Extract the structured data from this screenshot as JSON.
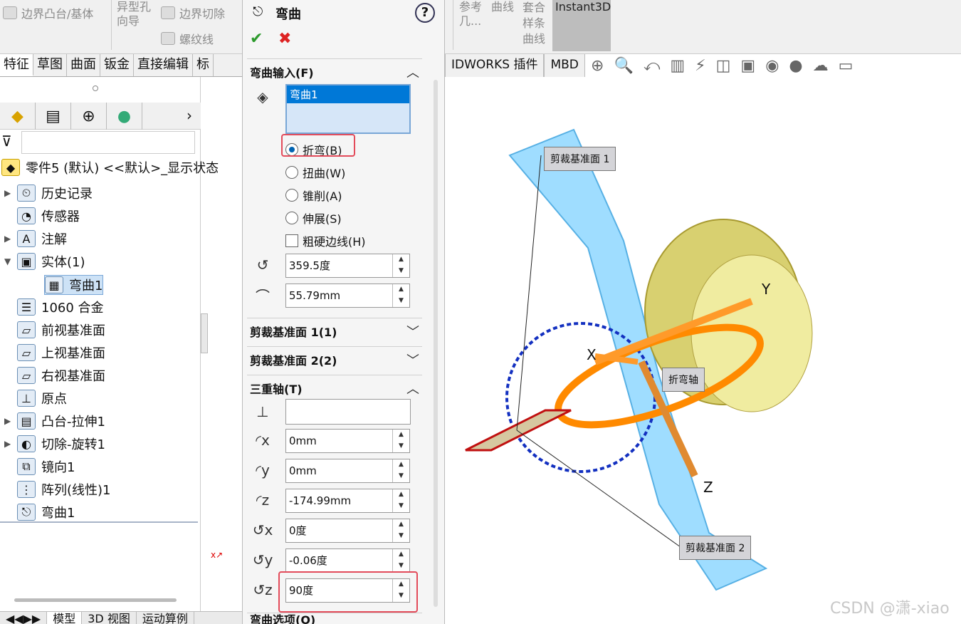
{
  "ribbon": {
    "boundary_boss": "边界凸台/基体",
    "hole_wizard": "异型孔\n向导",
    "boundary_cut": "边界切除",
    "thread": "螺纹线",
    "ref_geom": "参考\n几...",
    "curves": "曲线",
    "sketch_spline": "套合\n样条\n曲线",
    "instant3d": "Instant3D"
  },
  "tabs": [
    "特征",
    "草图",
    "曲面",
    "钣金",
    "直接编辑",
    "标"
  ],
  "feature_tabs": [
    "IDWORKS 插件",
    "MBD"
  ],
  "tree": {
    "root": "零件5 (默认) <<默认>_显示状态",
    "items": [
      {
        "label": "历史记录",
        "icon": "history-icon",
        "exp": "▶"
      },
      {
        "label": "传感器",
        "icon": "sensor-icon",
        "exp": ""
      },
      {
        "label": "注解",
        "icon": "annotation-icon",
        "exp": "▶"
      },
      {
        "label": "实体(1)",
        "icon": "solid-bodies-icon",
        "exp": "▼"
      },
      {
        "label": "弯曲1",
        "icon": "body-icon",
        "exp": ""
      },
      {
        "label": "1060 合金",
        "icon": "material-icon",
        "exp": ""
      },
      {
        "label": "前视基准面",
        "icon": "plane-icon",
        "exp": ""
      },
      {
        "label": "上视基准面",
        "icon": "plane-icon",
        "exp": ""
      },
      {
        "label": "右视基准面",
        "icon": "plane-icon",
        "exp": ""
      },
      {
        "label": "原点",
        "icon": "origin-icon",
        "exp": ""
      },
      {
        "label": "凸台-拉伸1",
        "icon": "extrude-icon",
        "exp": "▶"
      },
      {
        "label": "切除-旋转1",
        "icon": "revolve-cut-icon",
        "exp": "▶"
      },
      {
        "label": "镜向1",
        "icon": "mirror-icon",
        "exp": ""
      },
      {
        "label": "阵列(线性)1",
        "icon": "linear-pattern-icon",
        "exp": ""
      },
      {
        "label": "弯曲1",
        "icon": "flex-icon",
        "exp": ""
      }
    ]
  },
  "bottom_tabs": [
    "模型",
    "3D 视图",
    "运动算例"
  ],
  "pm": {
    "title": "弯曲",
    "help": "?",
    "ok": "✔",
    "cancel": "✖",
    "input_section": "弯曲输入(F)",
    "selected_body": "弯曲1",
    "opt_bend": "折弯(B)",
    "opt_twist": "扭曲(W)",
    "opt_taper": "锥削(A)",
    "opt_stretch": "伸展(S)",
    "hard_edges": "粗硬边线(H)",
    "angle": "359.5度",
    "radius": "55.79mm",
    "trim1": "剪裁基准面 1(1)",
    "trim2": "剪裁基准面 2(2)",
    "triad": "三重轴(T)",
    "x": "0mm",
    "y": "0mm",
    "z": "-174.99mm",
    "rx": "0度",
    "ry": "-0.06度",
    "rz": "90度",
    "options": "弯曲选项(O)"
  },
  "viewport": {
    "trim_plane_1": "剪裁基准面 1",
    "trim_plane_2": "剪裁基准面 2",
    "bend_axis": "折弯轴",
    "axis_x": "X",
    "axis_y": "Y",
    "axis_z": "Z",
    "watermark": "CSDN @潇-xiao"
  }
}
